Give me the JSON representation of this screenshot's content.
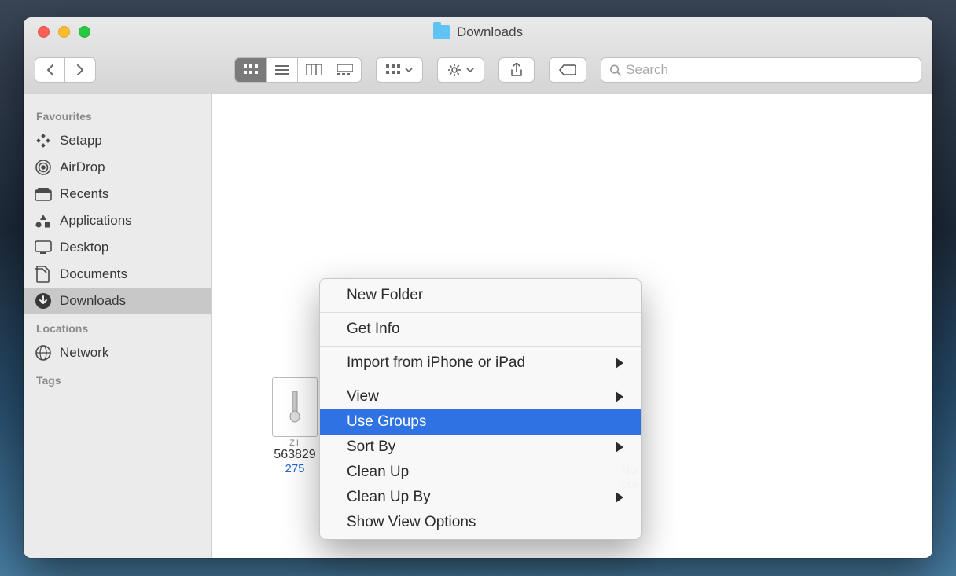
{
  "window": {
    "title": "Downloads"
  },
  "search": {
    "placeholder": "Search"
  },
  "sidebar": {
    "favourites_label": "Favourites",
    "locations_label": "Locations",
    "tags_label": "Tags",
    "favourites": [
      {
        "label": "Setapp",
        "icon": "setapp"
      },
      {
        "label": "AirDrop",
        "icon": "airdrop"
      },
      {
        "label": "Recents",
        "icon": "recents"
      },
      {
        "label": "Applications",
        "icon": "applications"
      },
      {
        "label": "Desktop",
        "icon": "desktop"
      },
      {
        "label": "Documents",
        "icon": "documents"
      },
      {
        "label": "Downloads",
        "icon": "downloads"
      }
    ],
    "locations": [
      {
        "label": "Network",
        "icon": "network"
      }
    ],
    "selected": "Downloads"
  },
  "files": {
    "left": {
      "thumb_tag": "ZI",
      "name": "563829",
      "subtext": "275"
    },
    "right": {
      "name_line1": "No",
      "name_line2": "obi"
    }
  },
  "context_menu": {
    "items": [
      {
        "label": "New Folder",
        "submenu": false,
        "sep_after": true
      },
      {
        "label": "Get Info",
        "submenu": false,
        "sep_after": true
      },
      {
        "label": "Import from iPhone or iPad",
        "submenu": true,
        "sep_after": true
      },
      {
        "label": "View",
        "submenu": true,
        "sep_after": false
      },
      {
        "label": "Use Groups",
        "submenu": false,
        "sep_after": false,
        "highlighted": true
      },
      {
        "label": "Sort By",
        "submenu": true,
        "sep_after": false
      },
      {
        "label": "Clean Up",
        "submenu": false,
        "sep_after": false
      },
      {
        "label": "Clean Up By",
        "submenu": true,
        "sep_after": false
      },
      {
        "label": "Show View Options",
        "submenu": false,
        "sep_after": false
      }
    ]
  }
}
